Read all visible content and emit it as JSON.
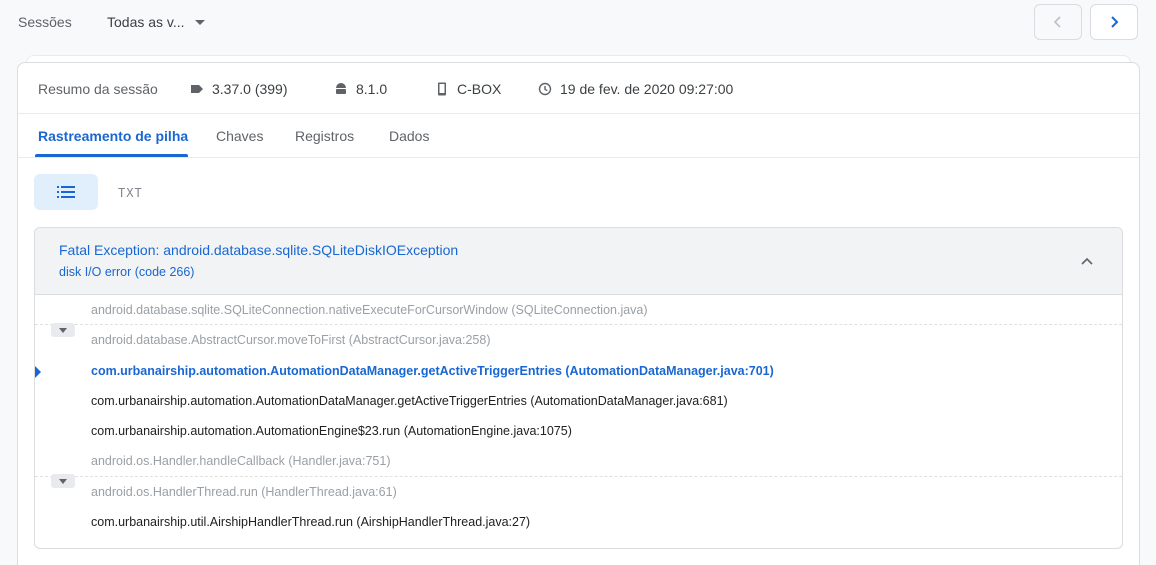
{
  "topbar": {
    "sessions_label": "Sessões",
    "filter_value": "Todas as v..."
  },
  "summary": {
    "title": "Resumo da sessão",
    "version": "3.37.0 (399)",
    "os_version": "8.1.0",
    "device": "C-BOX",
    "datetime": "19 de fev. de 2020 09:27:00"
  },
  "tabs": [
    {
      "label": "Rastreamento de pilha",
      "active": true
    },
    {
      "label": "Chaves",
      "active": false
    },
    {
      "label": "Registros",
      "active": false
    },
    {
      "label": "Dados",
      "active": false
    }
  ],
  "view": {
    "txt_label": "TXT"
  },
  "exception": {
    "title": "Fatal Exception: android.database.sqlite.SQLiteDiskIOException",
    "subtitle": "disk I/O error (code 266)"
  },
  "frames": [
    {
      "text": "android.database.sqlite.SQLiteConnection.nativeExecuteForCursorWindow (SQLiteConnection.java)",
      "style": "dim"
    },
    {
      "text": "android.database.AbstractCursor.moveToFirst (AbstractCursor.java:258)",
      "style": "dim"
    },
    {
      "text": "com.urbanairship.automation.AutomationDataManager.getActiveTriggerEntries (AutomationDataManager.java:701)",
      "style": "highlight"
    },
    {
      "text": "com.urbanairship.automation.AutomationDataManager.getActiveTriggerEntries (AutomationDataManager.java:681)",
      "style": "normal"
    },
    {
      "text": "com.urbanairship.automation.AutomationEngine$23.run (AutomationEngine.java:1075)",
      "style": "normal"
    },
    {
      "text": "android.os.Handler.handleCallback (Handler.java:751)",
      "style": "dim"
    },
    {
      "text": "android.os.HandlerThread.run (HandlerThread.java:61)",
      "style": "dim"
    },
    {
      "text": "com.urbanairship.util.AirshipHandlerThread.run (AirshipHandlerThread.java:27)",
      "style": "normal"
    }
  ],
  "colors": {
    "accent": "#1967d2",
    "dim_text": "#9aa0a6",
    "toggle_bg": "#e1effc"
  },
  "icons": {
    "prev": "chevron-left-icon",
    "next": "chevron-right-icon",
    "version": "tag-icon",
    "os": "android-icon",
    "device": "phone-icon",
    "datetime": "clock-icon",
    "list_view": "list-icon",
    "collapse": "chevron-up-icon"
  }
}
